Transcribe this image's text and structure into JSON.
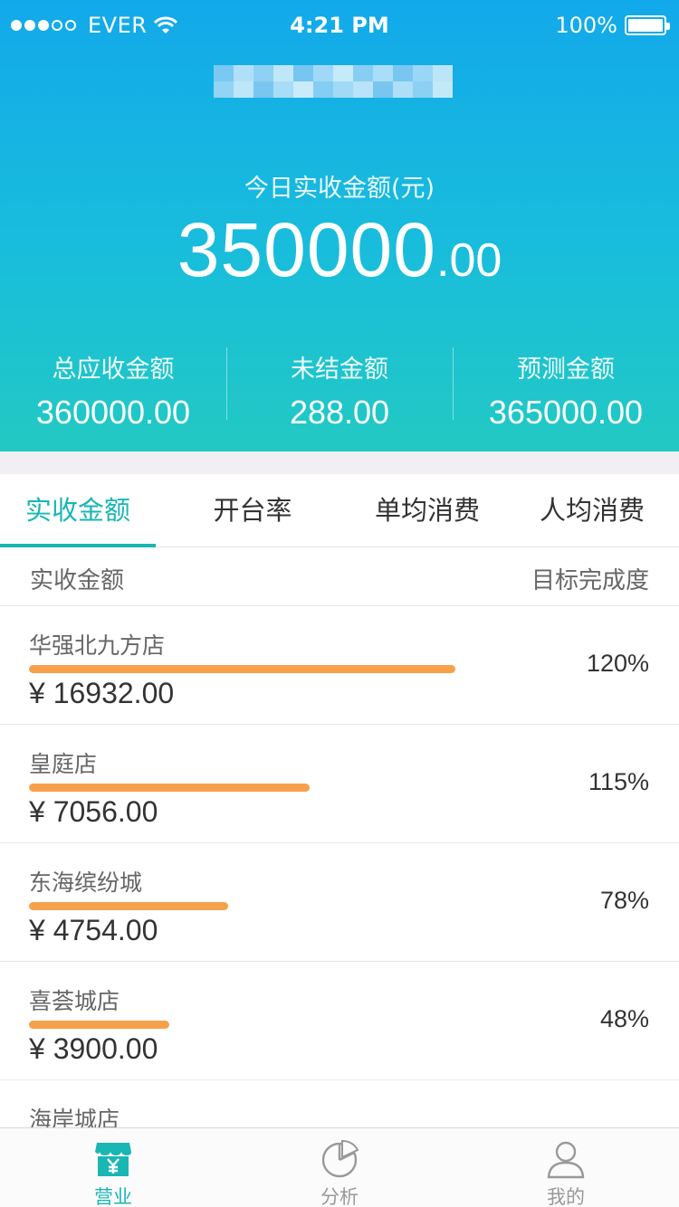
{
  "status_bar": {
    "carrier": "EVER",
    "time": "4:21 PM",
    "battery": "100%"
  },
  "header": {
    "today_label": "今日实收金额(元)",
    "today_amount_int": "350000",
    "today_amount_dec": ".00",
    "stats": [
      {
        "label": "总应收金额",
        "value": "360000.00"
      },
      {
        "label": "未结金额",
        "value": "288.00"
      },
      {
        "label": "预测金额",
        "value": "365000.00"
      }
    ]
  },
  "tabs": [
    {
      "label": "实收金额",
      "active": true
    },
    {
      "label": "开台率",
      "active": false
    },
    {
      "label": "单均消费",
      "active": false
    },
    {
      "label": "人均消费",
      "active": false
    }
  ],
  "list_header": {
    "left": "实收金额",
    "right": "目标完成度"
  },
  "stores": [
    {
      "name": "华强北九方店",
      "amount": "¥ 16932.00",
      "completion": "120%",
      "bar_fraction": 0.664
    },
    {
      "name": "皇庭店",
      "amount": "¥ 7056.00",
      "completion": "115%",
      "bar_fraction": 0.437
    },
    {
      "name": "东海缤纷城",
      "amount": "¥ 4754.00",
      "completion": "78%",
      "bar_fraction": 0.31
    },
    {
      "name": "喜荟城店",
      "amount": "¥ 3900.00",
      "completion": "48%",
      "bar_fraction": 0.219
    },
    {
      "name": "海岸城店",
      "amount": "",
      "completion": "",
      "bar_fraction": 0
    }
  ],
  "tabbar": [
    {
      "label": "营业",
      "icon": "store-icon",
      "active": true
    },
    {
      "label": "分析",
      "icon": "pie-chart-icon",
      "active": false
    },
    {
      "label": "我的",
      "icon": "user-icon",
      "active": false
    }
  ],
  "colors": {
    "header_top": "#12a9ea",
    "header_bottom": "#22c9c3",
    "accent": "#1ab6b4",
    "bar": "#f7a04b"
  }
}
